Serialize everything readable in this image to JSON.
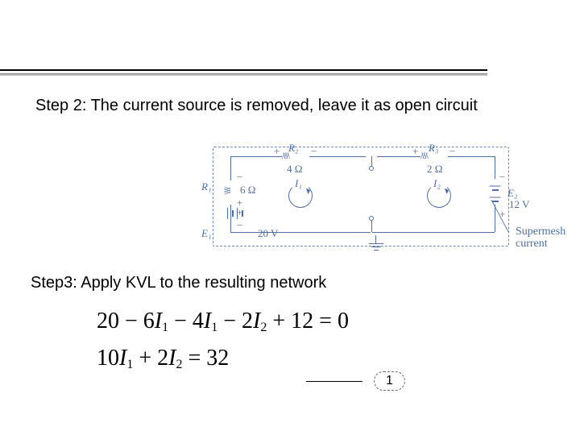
{
  "step2_text": "Step 2: The current source is removed, leave it as open circuit",
  "step3_text": "Step3: Apply KVL to the resulting network",
  "equations": {
    "line1": "20 − 6I₁ − 4I₁ − 2I₂ + 12 = 0",
    "line2": "10I₁ + 2I₂ = 32",
    "callout_number": "1"
  },
  "circuit": {
    "R1": {
      "name": "R₁",
      "value": "6 Ω"
    },
    "R2": {
      "name": "R₂",
      "value": "4 Ω"
    },
    "R3": {
      "name": "R₃",
      "value": "2 Ω"
    },
    "E1": {
      "name": "E₁",
      "value": "20 V"
    },
    "E2": {
      "name": "E₂",
      "value": "12 V"
    },
    "I1": "I₁",
    "I2": "I₂",
    "supermesh_label": "Supermesh current",
    "plus": "+",
    "minus": "−"
  }
}
